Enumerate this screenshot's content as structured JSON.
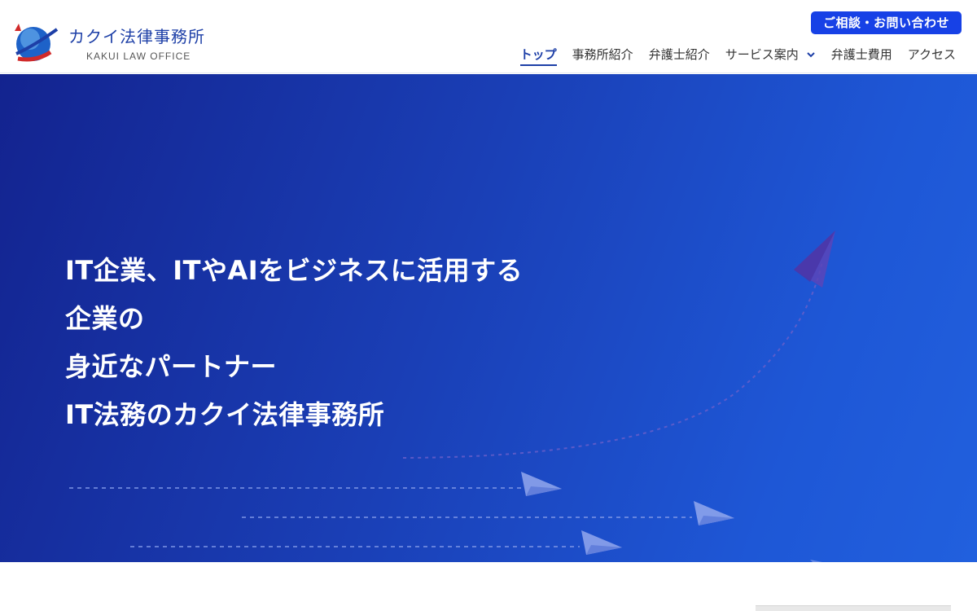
{
  "brand": {
    "name": "カクイ法律事務所",
    "sub": "KAKUI LAW OFFICE",
    "logo_icon": "globe-logo-icon"
  },
  "header": {
    "contact_label": "ご相談・お問い合わせ",
    "accent": "#1741e6"
  },
  "nav": {
    "items": [
      {
        "label": "トップ",
        "active": true
      },
      {
        "label": "事務所紹介"
      },
      {
        "label": "弁護士紹介"
      },
      {
        "label": "サービス案内",
        "dropdown": true
      },
      {
        "label": "弁護士費用"
      },
      {
        "label": "アクセス"
      }
    ]
  },
  "hero": {
    "lines": [
      "IT企業、ITやAIをビジネスに活用する",
      "企業の",
      "身近なパートナー",
      "IT法務のカクイ法律事務所"
    ],
    "bg_color_start": "#13238f",
    "bg_color_end": "#2160de"
  }
}
